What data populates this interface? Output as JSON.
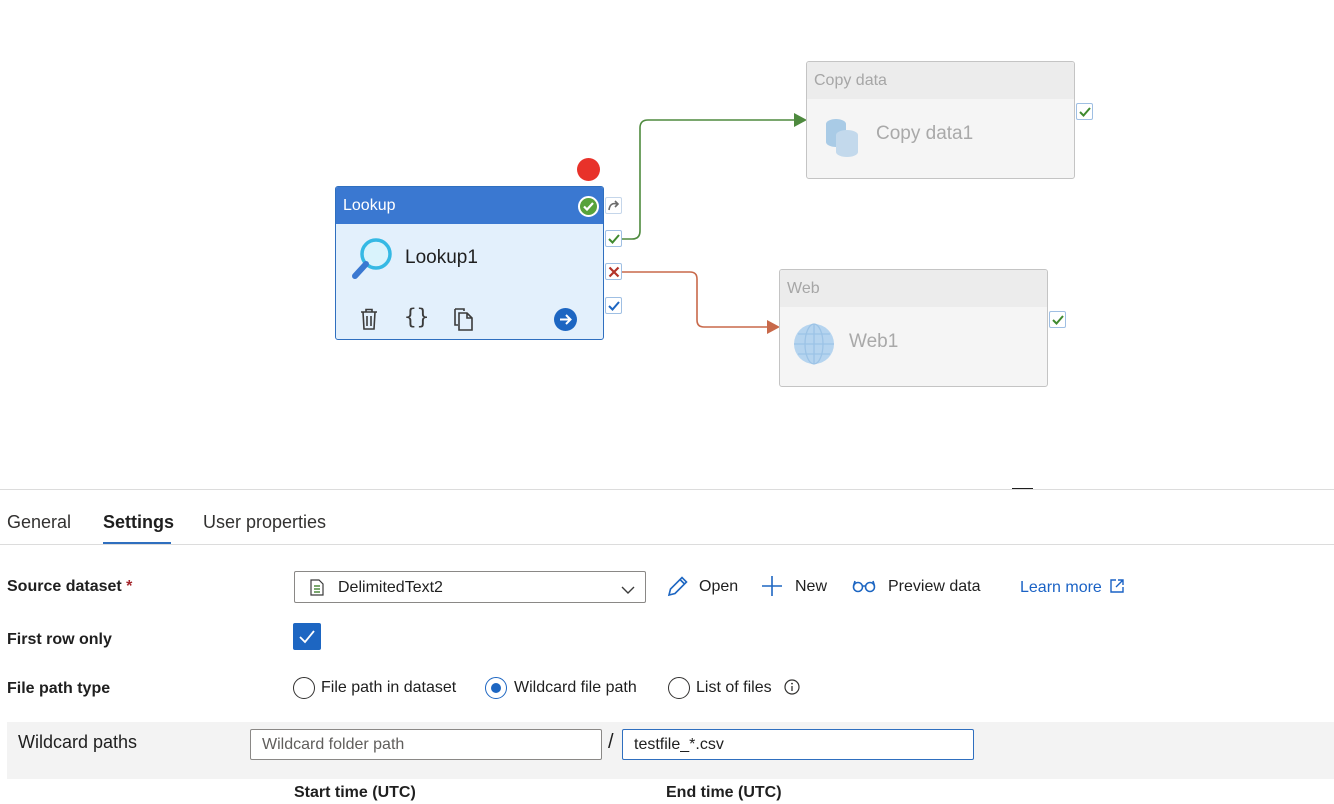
{
  "pipeline": {
    "lookup": {
      "type_label": "Lookup",
      "name": "Lookup1"
    },
    "copy": {
      "type_label": "Copy data",
      "name": "Copy data1"
    },
    "web": {
      "type_label": "Web",
      "name": "Web1"
    }
  },
  "tabs": [
    "General",
    "Settings",
    "User properties"
  ],
  "active_tab": "Settings",
  "settings": {
    "source_dataset": {
      "label": "Source dataset",
      "required_mark": "*",
      "value": "DelimitedText2",
      "actions": {
        "open": "Open",
        "new": "New",
        "preview": "Preview data"
      },
      "learn_more": "Learn more"
    },
    "first_row_only": {
      "label": "First row only",
      "checked": true
    },
    "file_path_type": {
      "label": "File path type",
      "options": [
        "File path in dataset",
        "Wildcard file path",
        "List of files"
      ],
      "selected": "Wildcard file path"
    },
    "wildcard_paths": {
      "label": "Wildcard paths",
      "folder_placeholder": "Wildcard folder path",
      "separator": "/",
      "file_value": "testfile_*.csv"
    },
    "start_time_label": "Start time (UTC)",
    "end_time_label": "End time (UTC)"
  },
  "colors": {
    "accent": "#3a78d1",
    "success_link": "#4e8a3e",
    "failure_link": "#c8694a",
    "error_dot": "#e8322a"
  }
}
